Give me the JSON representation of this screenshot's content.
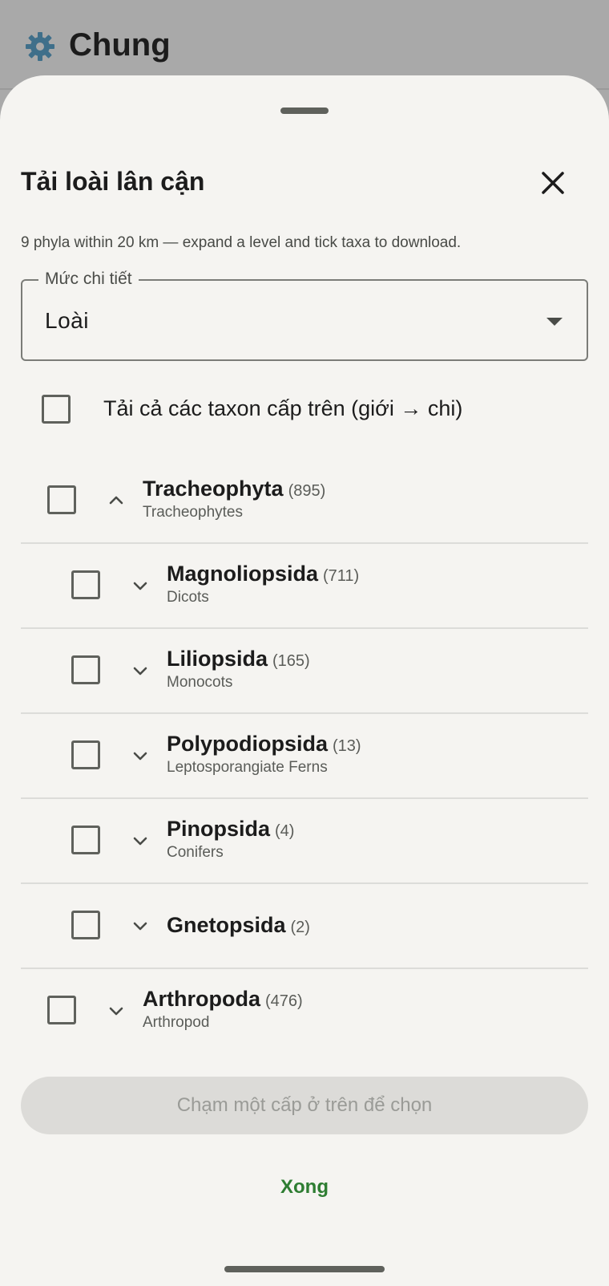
{
  "app_header": {
    "title": "Chung",
    "icon": "gear-icon"
  },
  "sheet": {
    "title": "Tải loài lân cận",
    "subtitle": "9 phyla within 20 km — expand a level and tick taxa to download.",
    "close_icon": "close-icon"
  },
  "detail_field": {
    "label": "Mức chi tiết",
    "value": "Loài"
  },
  "parents_option": {
    "label": "Tải cả các taxon cấp trên (giới → chi)",
    "checked": false
  },
  "taxa": [
    {
      "name": "Tracheophyta",
      "count": "(895)",
      "common": "Tracheophytes",
      "expanded": true,
      "level": 0,
      "checked": false
    },
    {
      "name": "Magnoliopsida",
      "count": "(711)",
      "common": "Dicots",
      "expanded": false,
      "level": 1,
      "checked": false
    },
    {
      "name": "Liliopsida",
      "count": "(165)",
      "common": "Monocots",
      "expanded": false,
      "level": 1,
      "checked": false
    },
    {
      "name": "Polypodiopsida",
      "count": "(13)",
      "common": "Leptosporangiate Ferns",
      "expanded": false,
      "level": 1,
      "checked": false
    },
    {
      "name": "Pinopsida",
      "count": "(4)",
      "common": "Conifers",
      "expanded": false,
      "level": 1,
      "checked": false
    },
    {
      "name": "Gnetopsida",
      "count": "(2)",
      "common": "",
      "expanded": false,
      "level": 1,
      "checked": false
    },
    {
      "name": "Arthropoda",
      "count": "(476)",
      "common": "Arthropod",
      "expanded": false,
      "level": 0,
      "checked": false
    }
  ],
  "actions": {
    "pick_label": "Chạm một cấp ở trên để chọn",
    "done_label": "Xong"
  },
  "colors": {
    "accent": "#2e7d32",
    "sheet_bg": "#f5f4f1",
    "scrim": "#a9a9a9",
    "gear": "#3f6f8a"
  }
}
